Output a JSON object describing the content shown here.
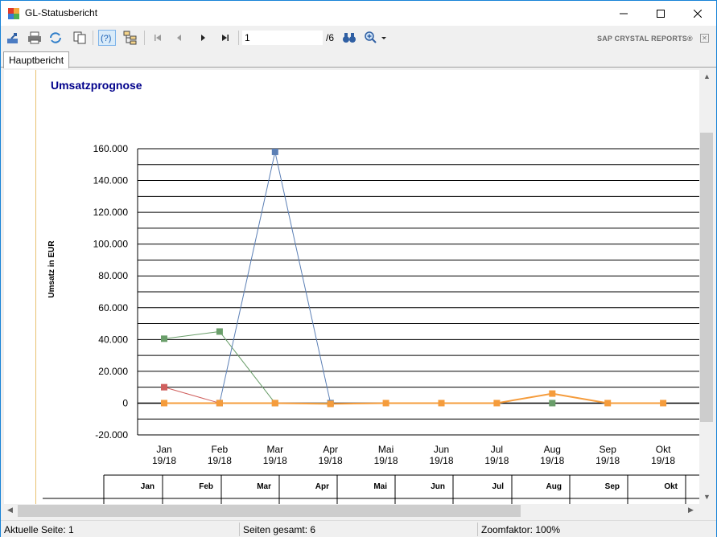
{
  "window": {
    "title": "GL-Statusbericht"
  },
  "toolbar": {
    "page_value": "1",
    "page_total": "/6",
    "brand": "SAP CRYSTAL REPORTS®"
  },
  "tabs": [
    {
      "label": "Hauptbericht"
    }
  ],
  "report": {
    "title": "Umsatzprognose"
  },
  "chart_data": {
    "type": "line",
    "ylabel": "Umsatz in EUR",
    "ylim": [
      -20000,
      160000
    ],
    "y_ticks": [
      "160.000",
      "140.000",
      "120.000",
      "100.000",
      "80.000",
      "60.000",
      "40.000",
      "20.000",
      "0",
      "-20.000"
    ],
    "y_tick_values": [
      160000,
      140000,
      120000,
      100000,
      80000,
      60000,
      40000,
      20000,
      0,
      -20000
    ],
    "grid": true,
    "categories": [
      "Jan 19/18",
      "Feb 19/18",
      "Mar 19/18",
      "Apr 19/18",
      "Mai 19/18",
      "Jun 19/18",
      "Jul 19/18",
      "Aug 19/18",
      "Sep 19/18",
      "Okt 19/18"
    ],
    "category_lines": [
      [
        "Jan",
        "19/18"
      ],
      [
        "Feb",
        "19/18"
      ],
      [
        "Mar",
        "19/18"
      ],
      [
        "Apr",
        "19/18"
      ],
      [
        "Mai",
        "19/18"
      ],
      [
        "Jun",
        "19/18"
      ],
      [
        "Jul",
        "19/18"
      ],
      [
        "Aug",
        "19/18"
      ],
      [
        "Sep",
        "19/18"
      ],
      [
        "Okt",
        "19/18"
      ]
    ],
    "series": [
      {
        "color": "#d0605e",
        "values": [
          10000,
          0,
          null,
          null,
          null,
          null,
          null,
          null,
          null,
          null
        ]
      },
      {
        "color": "#6a9e6a",
        "values": [
          40500,
          45000,
          0,
          0,
          null,
          null,
          null,
          0,
          null,
          null
        ]
      },
      {
        "color": "#5b7fb5",
        "values": [
          null,
          0,
          158000,
          0,
          null,
          null,
          null,
          null,
          null,
          null
        ]
      },
      {
        "color": "#f59c3c",
        "values": [
          0,
          0,
          0,
          -500,
          0,
          0,
          0,
          6000,
          0,
          0
        ]
      }
    ]
  },
  "table": {
    "headers": [
      "Jan",
      "Feb",
      "Mar",
      "Apr",
      "Mai",
      "Jun",
      "Jul",
      "Aug",
      "Sep",
      "Okt"
    ]
  },
  "status": {
    "current_page": "Aktuelle Seite: 1",
    "total_pages": "Seiten gesamt: 6",
    "zoom": "Zoomfaktor: 100%"
  }
}
